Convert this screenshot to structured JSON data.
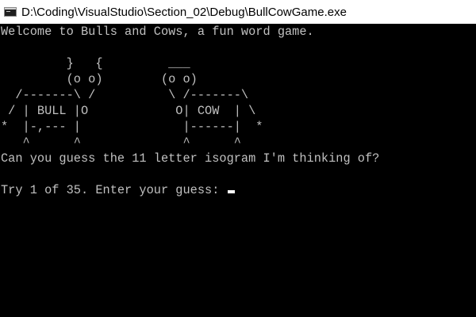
{
  "window": {
    "title": "D:\\Coding\\VisualStudio\\Section_02\\Debug\\BullCowGame.exe",
    "icon": "console-app-icon"
  },
  "console": {
    "welcome": "Welcome to Bulls and Cows, a fun word game.",
    "art": [
      "         }   {         ___",
      "         (o o)        (o o)",
      "  /-------\\ /          \\ /-------\\",
      " / | BULL |O            O| COW  | \\",
      "*  |-,--- |              |------|  *",
      "   ^      ^              ^      ^"
    ],
    "question": "Can you guess the 11 letter isogram I'm thinking of?",
    "prompt": "Try 1 of 35. Enter your guess: "
  },
  "colors": {
    "background": "#000000",
    "text": "#c0c0c0",
    "titlebar": "#ffffff"
  }
}
